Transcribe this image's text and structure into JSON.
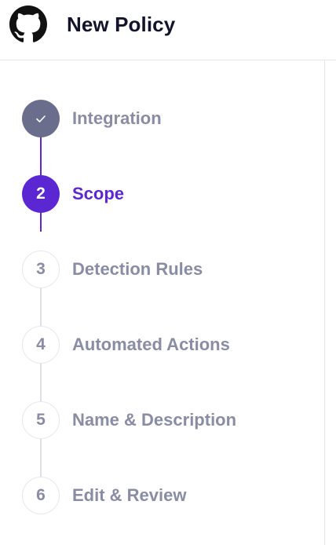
{
  "header": {
    "title": "New Policy",
    "logo_icon": "github-octocat-icon"
  },
  "steps": [
    {
      "number": "✓",
      "label": "Integration",
      "state": "completed"
    },
    {
      "number": "2",
      "label": "Scope",
      "state": "active"
    },
    {
      "number": "3",
      "label": "Detection Rules",
      "state": "pending"
    },
    {
      "number": "4",
      "label": "Automated Actions",
      "state": "pending"
    },
    {
      "number": "5",
      "label": "Name & Description",
      "state": "pending"
    },
    {
      "number": "6",
      "label": "Edit & Review",
      "state": "pending"
    }
  ],
  "colors": {
    "accent": "#5a27d2",
    "completed": "#6b6d8c",
    "muted_text": "#8a8ca3",
    "title_text": "#13142b"
  }
}
